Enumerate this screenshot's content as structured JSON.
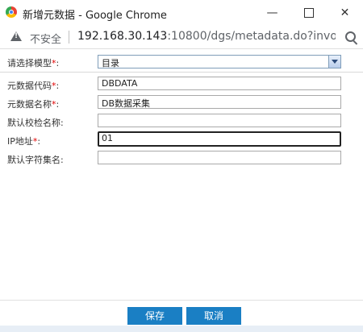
{
  "window": {
    "title": "新增元数据 - Google Chrome",
    "min_glyph": "—",
    "close_glyph": "✕"
  },
  "address": {
    "security_label": "不安全",
    "url_host": "192.168.30.143",
    "url_rest": ":10800/dgs/metadata.do?invo..."
  },
  "form": {
    "model_label": "请选择模型",
    "model_value": "目录",
    "fields": [
      {
        "label": "元数据代码",
        "required": "*",
        "value": "DBDATA"
      },
      {
        "label": "元数据名称",
        "required": "*",
        "value": "DB数据采集"
      },
      {
        "label": "默认校检名称",
        "required": "",
        "value": ""
      },
      {
        "label": "IP地址",
        "required": "*",
        "value": "01"
      },
      {
        "label": "默认字符集名",
        "required": "",
        "value": ""
      }
    ],
    "colon": ":"
  },
  "buttons": {
    "save": "保存",
    "cancel": "取消"
  },
  "colors": {
    "button": "#1a7fc4",
    "required": "#e00000"
  }
}
